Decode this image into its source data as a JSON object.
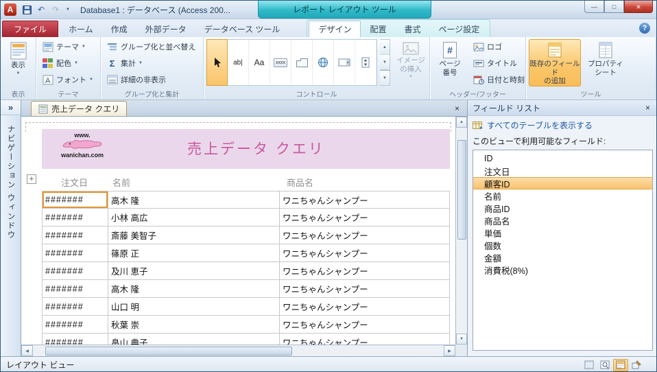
{
  "window": {
    "title": "Database1 : データベース (Access 200...",
    "contextual_title": "レポート レイアウト ツール"
  },
  "tabs": {
    "file": "ファイル",
    "home": "ホーム",
    "create": "作成",
    "external_data": "外部データ",
    "db_tools": "データベース ツール",
    "design": "デザイン",
    "arrange": "配置",
    "format": "書式",
    "page_setup": "ページ設定"
  },
  "ribbon": {
    "view_group": {
      "button": "表示",
      "label": "表示"
    },
    "themes_group": {
      "themes": "テーマ",
      "colors": "配色",
      "fonts": "フォント",
      "label": "テーマ"
    },
    "grouping_group": {
      "group_sort": "グループ化と並べ替え",
      "totals": "集計",
      "hide_details": "詳細の非表示",
      "label": "グループ化と集計"
    },
    "controls_group": {
      "label": "コントロール",
      "insert_image": "イメージ\nの挿入"
    },
    "header_footer_group": {
      "page_number": "ページ\n番号",
      "logo": "ロゴ",
      "title": "タイトル",
      "date_time": "日付と時刻",
      "label": "ヘッダー/フッター"
    },
    "tools_group": {
      "add_fields": "既存のフィールド\nの追加",
      "property_sheet": "プロパティ\nシート",
      "label": "ツール"
    }
  },
  "nav_pane": {
    "title": "ナビゲーション ウィンドウ"
  },
  "document": {
    "tab_title": "売上データ クエリ",
    "report": {
      "logo_line1": "www.",
      "logo_line2": "wanichan.com",
      "title": "売上データ クエリ",
      "columns": [
        "注文日",
        "名前",
        "商品名"
      ],
      "rows": [
        {
          "date": "#######",
          "name": "高木 隆",
          "product": "ワニちゃんシャンプー"
        },
        {
          "date": "#######",
          "name": "小林 高広",
          "product": "ワニちゃんシャンプー"
        },
        {
          "date": "#######",
          "name": "斎藤 美智子",
          "product": "ワニちゃんシャンプー"
        },
        {
          "date": "#######",
          "name": "篠原 正",
          "product": "ワニちゃんシャンプー"
        },
        {
          "date": "#######",
          "name": "及川 恵子",
          "product": "ワニちゃんシャンプー"
        },
        {
          "date": "#######",
          "name": "高木 隆",
          "product": "ワニちゃんシャンプー"
        },
        {
          "date": "#######",
          "name": "山口 明",
          "product": "ワニちゃんシャンプー"
        },
        {
          "date": "#######",
          "name": "秋葉 崇",
          "product": "ワニちゃんシャンプー"
        },
        {
          "date": "#######",
          "name": "畠山 典子",
          "product": "ワニちゃんシャンプー"
        }
      ]
    }
  },
  "field_list": {
    "title": "フィールド リスト",
    "show_all_link": "すべてのテーブルを表示する",
    "available_label": "このビューで利用可能なフィールド:",
    "items": [
      "ID",
      "注文日",
      "顧客ID",
      "名前",
      "商品ID",
      "商品名",
      "単価",
      "個数",
      "金額",
      "消費税(8%)"
    ],
    "selected_item": "顧客ID"
  },
  "status_bar": {
    "view_name": "レイアウト ビュー"
  },
  "icons": {
    "dropdown": "▼",
    "close": "×",
    "nav_expand": "»",
    "sigma": "Σ",
    "hash": "#",
    "undo": "↶",
    "redo": "↷",
    "help": "?",
    "minimize": "—",
    "maximize": "□",
    "move_anchor": "+",
    "textbox_ab": "ab|",
    "label_Aa": "Aa",
    "button_xxxx": "xxxx",
    "up": "▲",
    "down": "▼",
    "left": "◀",
    "right": "▶",
    "app_letter": "A"
  },
  "colors": {
    "contextual_tab": "#2cb5c4",
    "file_tab": "#ac2b35",
    "selection_orange": "#e1962f",
    "report_header_bg": "#ebd7eb",
    "report_title_text": "#c7589f",
    "field_selected_bg": "#fac26e"
  }
}
